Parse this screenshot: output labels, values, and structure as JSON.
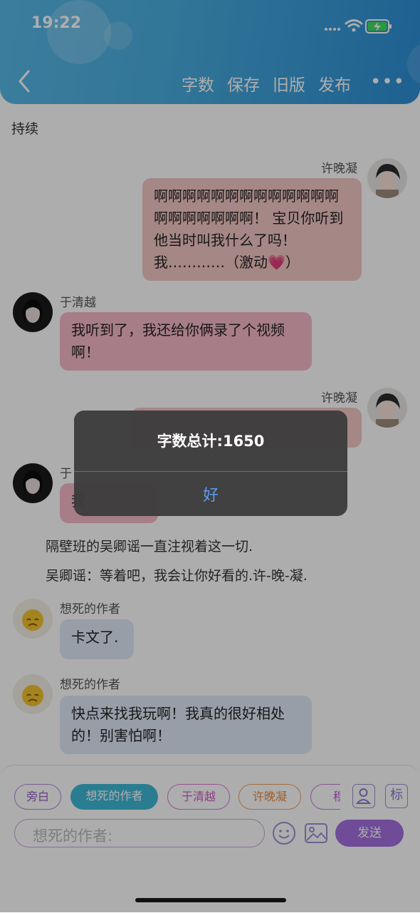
{
  "status": {
    "time": "19:22"
  },
  "toolbar": {
    "word_count": "字数",
    "save": "保存",
    "old_version": "旧版",
    "publish": "发布",
    "more": "•••"
  },
  "section_title": "持续",
  "messages": [
    {
      "name": "许晚凝",
      "text": "啊啊啊啊啊啊啊啊啊啊啊啊啊啊啊啊啊啊啊啊！ 宝贝你听到他当时叫我什么了吗！我…………（激动💗）"
    },
    {
      "name": "于清越",
      "text": "我听到了，我还给你俩录了个视频啊！"
    },
    {
      "name": "许晚凝",
      "text": ""
    },
    {
      "name": "于",
      "text": "我"
    },
    {
      "name": "想死的作者",
      "text": "卡文了."
    },
    {
      "name": "想死的作者",
      "text": "快点来找我玩啊！我真的很好相处的！别害怕啊！"
    }
  ],
  "narration": [
    "隔壁班的吴卿谣一直注视着这一切.",
    "吴卿谣：等着吧，我会让你好看的.许-晚-凝."
  ],
  "alert": {
    "title": "字数总计:1650",
    "ok": "好"
  },
  "roles": [
    "旁白",
    "想死的作者",
    "于清越",
    "许晚凝",
    "穆"
  ],
  "toolbar_icons": {
    "role_icon": "person-icon",
    "mark": "标"
  },
  "input": {
    "placeholder": "想死的作者:"
  },
  "send_label": "发送",
  "colors": {
    "header": "#4aaee0",
    "send": "#a46fe0",
    "chip_selected": "#3fb8d6",
    "alert_ok": "#5a9bf0"
  }
}
